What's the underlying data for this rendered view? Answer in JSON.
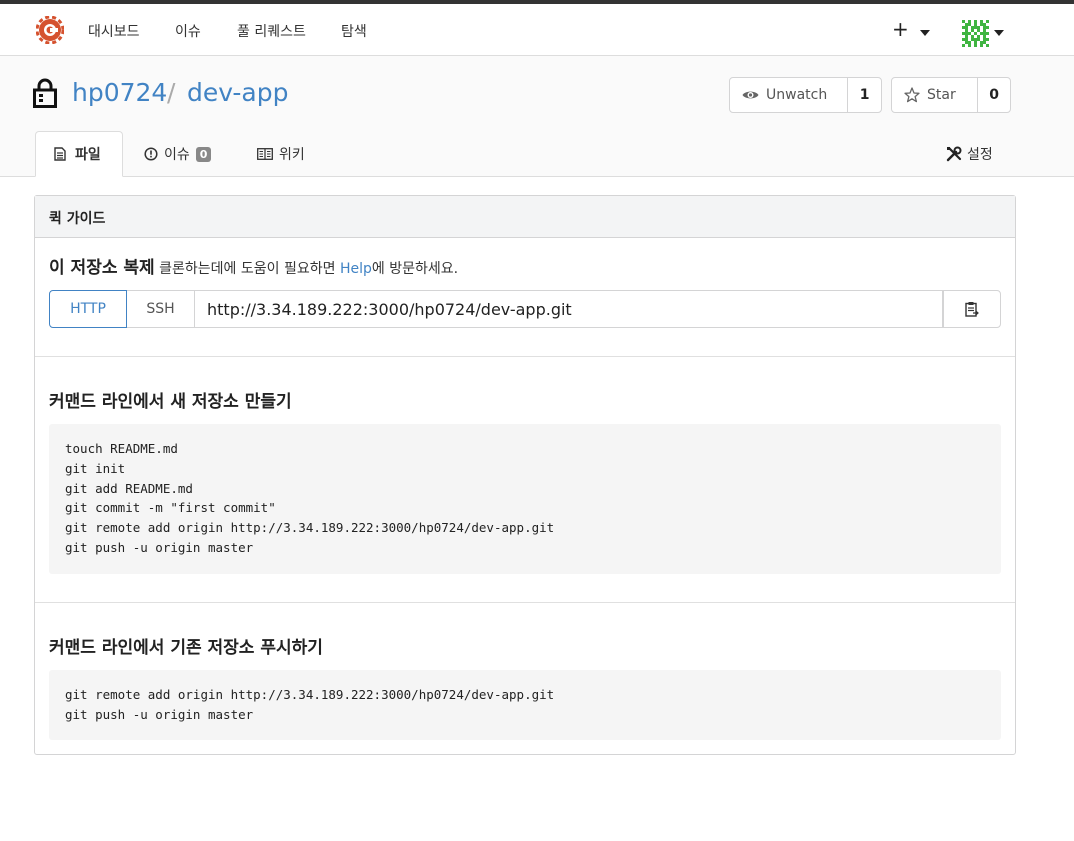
{
  "nav": {
    "links": [
      "대시보드",
      "이슈",
      "풀 리퀘스트",
      "탐색"
    ],
    "plus_icon": "plus-icon"
  },
  "repo": {
    "owner": "hp0724",
    "separator": "/",
    "name": "dev-app",
    "watch_label": "Unwatch",
    "watch_count": "1",
    "star_label": "Star",
    "star_count": "0"
  },
  "tabs": {
    "files": "파일",
    "issues": "이슈",
    "issues_count": "0",
    "wiki": "위키",
    "settings": "설정"
  },
  "guide": {
    "title": "퀵 가이드",
    "clone_title": "이 저장소 복제",
    "clone_desc_prefix": "클론하는데에 도움이 필요하면 ",
    "clone_help": "Help",
    "clone_desc_suffix": "에 방문하세요.",
    "http_label": "HTTP",
    "ssh_label": "SSH",
    "clone_url": "http://3.34.189.222:3000/hp0724/dev-app.git",
    "new_repo_title": "커맨드 라인에서 새 저장소 만들기",
    "new_repo_code": [
      "touch README.md",
      "git init",
      "git add README.md",
      "git commit -m \"first commit\"",
      "git remote add origin http://3.34.189.222:3000/hp0724/dev-app.git",
      "git push -u origin master"
    ],
    "push_title": "커맨드 라인에서 기존 저장소 푸시하기",
    "push_code": [
      "git remote add origin http://3.34.189.222:3000/hp0724/dev-app.git",
      "git push -u origin master"
    ]
  },
  "colors": {
    "link": "#4183c4",
    "border": "#d4d4d5",
    "code_bg": "#f5f5f5"
  }
}
